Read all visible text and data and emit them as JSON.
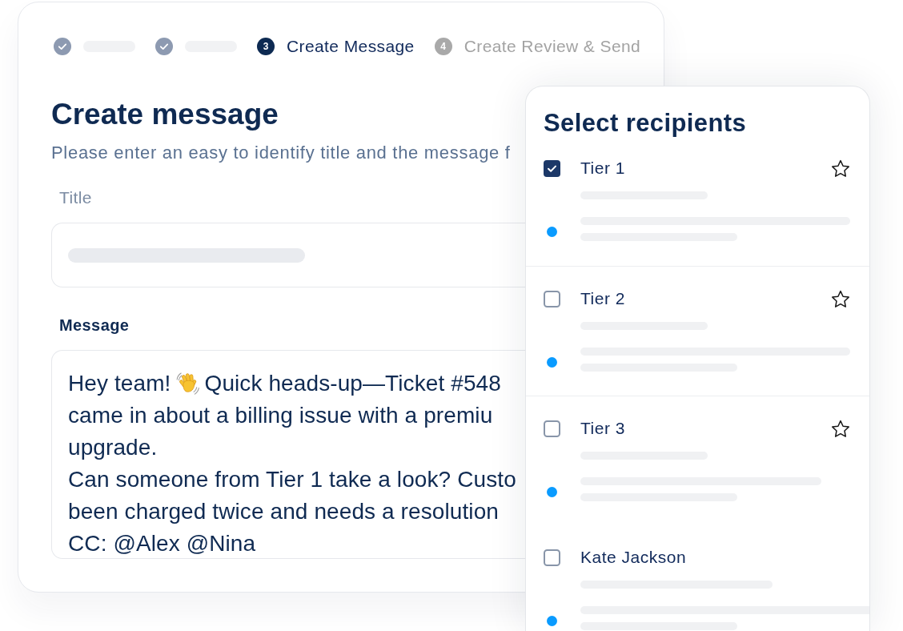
{
  "stepper": {
    "steps": [
      {
        "completed": true,
        "selected": false
      },
      {
        "completed": true,
        "selected": false
      },
      {
        "completed": false,
        "selected": true,
        "number": "3",
        "label": "Create Message"
      },
      {
        "completed": false,
        "selected": false,
        "number": "4",
        "label": "Create Review & Send"
      }
    ]
  },
  "form": {
    "title": "Create message",
    "subtitle": "Please enter an easy to identify title and the message f"
  },
  "title_field": {
    "label": "Title"
  },
  "message_field": {
    "label": "Message",
    "greeting": "Hey team!",
    "lines": [
      "Quick heads-up—Ticket #548",
      "came in about a billing issue with a premiu",
      "upgrade.",
      "Can someone from Tier 1 take a look? Custo",
      "been charged twice and needs a resolution",
      "CC: @Alex @Nina"
    ]
  },
  "recipients": {
    "title": "Select recipients",
    "items": [
      {
        "kind": "group",
        "label": "Tier 1",
        "checked": true,
        "starred": false
      },
      {
        "kind": "group",
        "label": "Tier 2",
        "checked": false,
        "starred": false
      },
      {
        "kind": "group",
        "label": "Tier 3",
        "checked": false,
        "starred": false
      },
      {
        "kind": "person",
        "label": "Kate Jackson",
        "checked": false
      }
    ]
  }
}
